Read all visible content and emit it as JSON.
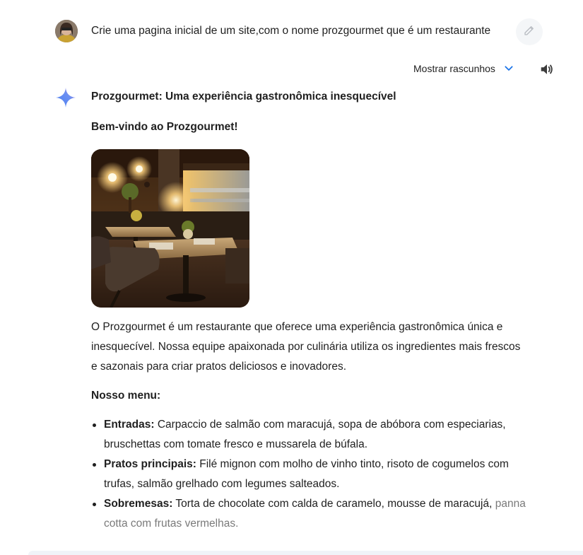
{
  "user_prompt": {
    "text": "Crie uma pagina inicial de um site,com o nome prozgourmet que é um restaurante"
  },
  "drafts": {
    "label": "Mostrar rascunhos"
  },
  "response": {
    "title": "Prozgourmet: Uma experiência gastronômica inesquecível",
    "welcome": "Bem-vindo ao Prozgourmet!",
    "intro": "O Prozgourmet é um restaurante que oferece uma experiência gastronômica única e inesquecível. Nossa equipe apaixonada por culinária utiliza os ingredientes mais frescos e sazonais para criar pratos deliciosos e inovadores.",
    "menu_title": "Nosso menu:",
    "menu_items": [
      {
        "label": "Entradas:",
        "text": "Carpaccio de salmão com maracujá, sopa de abóbora com especiarias, bruschettas com tomate fresco e mussarela de búfala."
      },
      {
        "label": "Pratos principais:",
        "text": "Filé mignon com molho de vinho tinto, risoto de cogumelos com trufas, salmão grelhado com legumes salteados."
      },
      {
        "label": "Sobremesas:",
        "text_main": "Torta de chocolate com calda de caramelo, mousse de maracujá,",
        "text_faded": "panna cotta com frutas vermelhas."
      }
    ]
  },
  "icons": {
    "edit": "pencil-icon",
    "expand": "chevron-down-icon",
    "audio": "speaker-icon",
    "assistant": "sparkle-icon"
  },
  "colors": {
    "accent": "#1a73e8",
    "text": "#1f1f1f",
    "faded_text": "#7a7a7a"
  }
}
